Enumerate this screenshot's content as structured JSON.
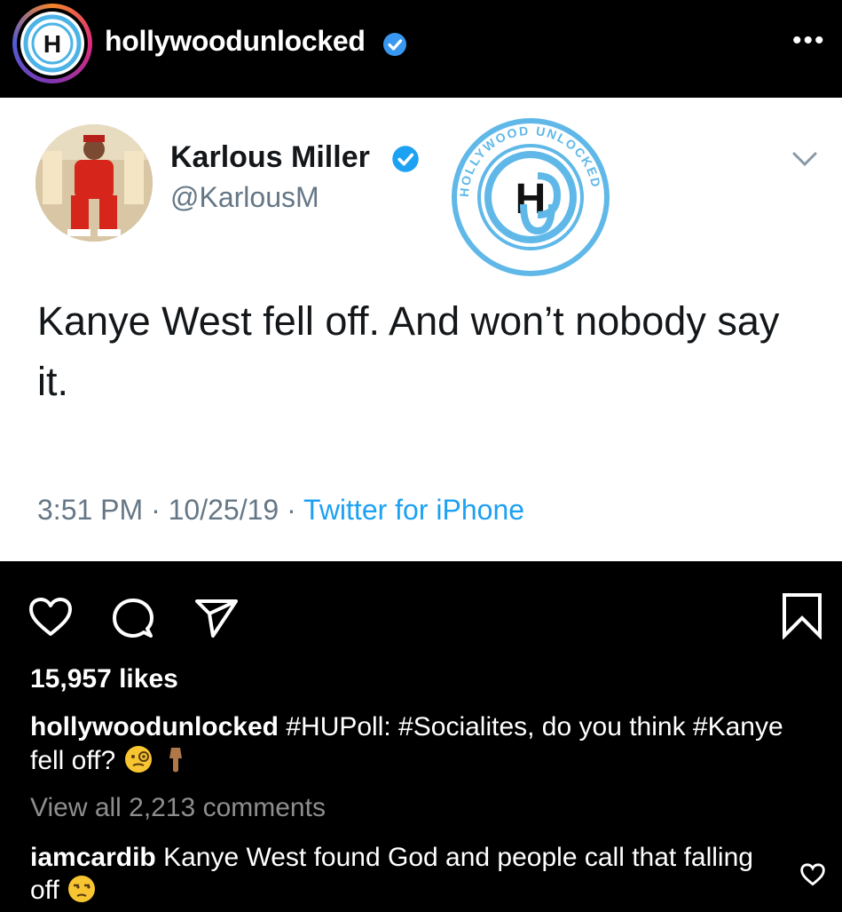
{
  "post": {
    "username": "hollywoodunlocked",
    "more_label": "•••"
  },
  "tweet": {
    "name": "Karlous Miller",
    "handle": "@KarlousM",
    "text": "Kanye West fell off. And won’t nobody say it.",
    "time_date": "3:51 PM · 10/25/19 · ",
    "source": "Twitter for iPhone",
    "watermark_text": "HOLLYWOOD UNLOCKED"
  },
  "engagement": {
    "likes": "15,957 likes"
  },
  "caption": {
    "username": "hollywoodunlocked",
    "text": " #HUPoll: #Socialites, do you think #Kanye fell off? "
  },
  "comments": {
    "view_all": "View all 2,213 comments",
    "top_comment_user": "iamcardib",
    "top_comment_text": " Kanye West found God and people call that falling off "
  },
  "colors": {
    "verified_blue": "#1da1f2",
    "instagram_blue": "#3897f0",
    "muted": "#8e8e8e"
  },
  "icons": [
    "verified-icon",
    "more-icon",
    "chevron-down-icon",
    "heart-icon",
    "comment-icon",
    "share-icon",
    "bookmark-icon",
    "small-heart-icon"
  ]
}
